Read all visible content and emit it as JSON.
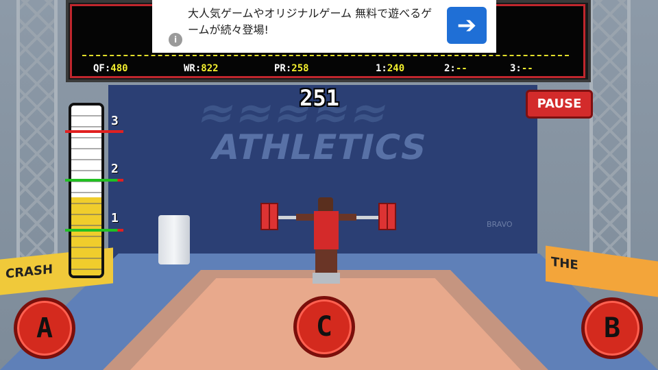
{
  "scoreboard": {
    "qf_label": "QF:",
    "qf_value": "480",
    "wr_label": "WR:",
    "wr_value": "822",
    "pr_label": "PR:",
    "pr_value": "258",
    "rank1_label": "1:",
    "rank1_value": "240",
    "rank2_label": "2:",
    "rank2_value": "--",
    "rank3_label": "3:",
    "rank3_value": "--"
  },
  "ad": {
    "text": "大人気ゲームやオリジナルゲーム 無料で遊べるゲームが続々登場!",
    "info_icon": "i",
    "arrow_icon": "➔"
  },
  "counter": "251",
  "pause_label": "PAUSE",
  "meter": {
    "fill_fraction": 0.46,
    "marks": [
      "3",
      "2",
      "1"
    ]
  },
  "backdrop": {
    "logo_line2": "ATHLETICS",
    "sponsor": "BRAVO"
  },
  "banners": {
    "left": "CRASH",
    "right": "THE"
  },
  "controls": {
    "a_label": "A",
    "c_label": "C",
    "b_label": "B"
  },
  "colors": {
    "accent_red": "#d32b2b",
    "scoreboard_yellow": "#f2ef2e",
    "meter_yellow": "#f0cd2c",
    "mark_green": "#22c022",
    "mark_red": "#e02020"
  }
}
